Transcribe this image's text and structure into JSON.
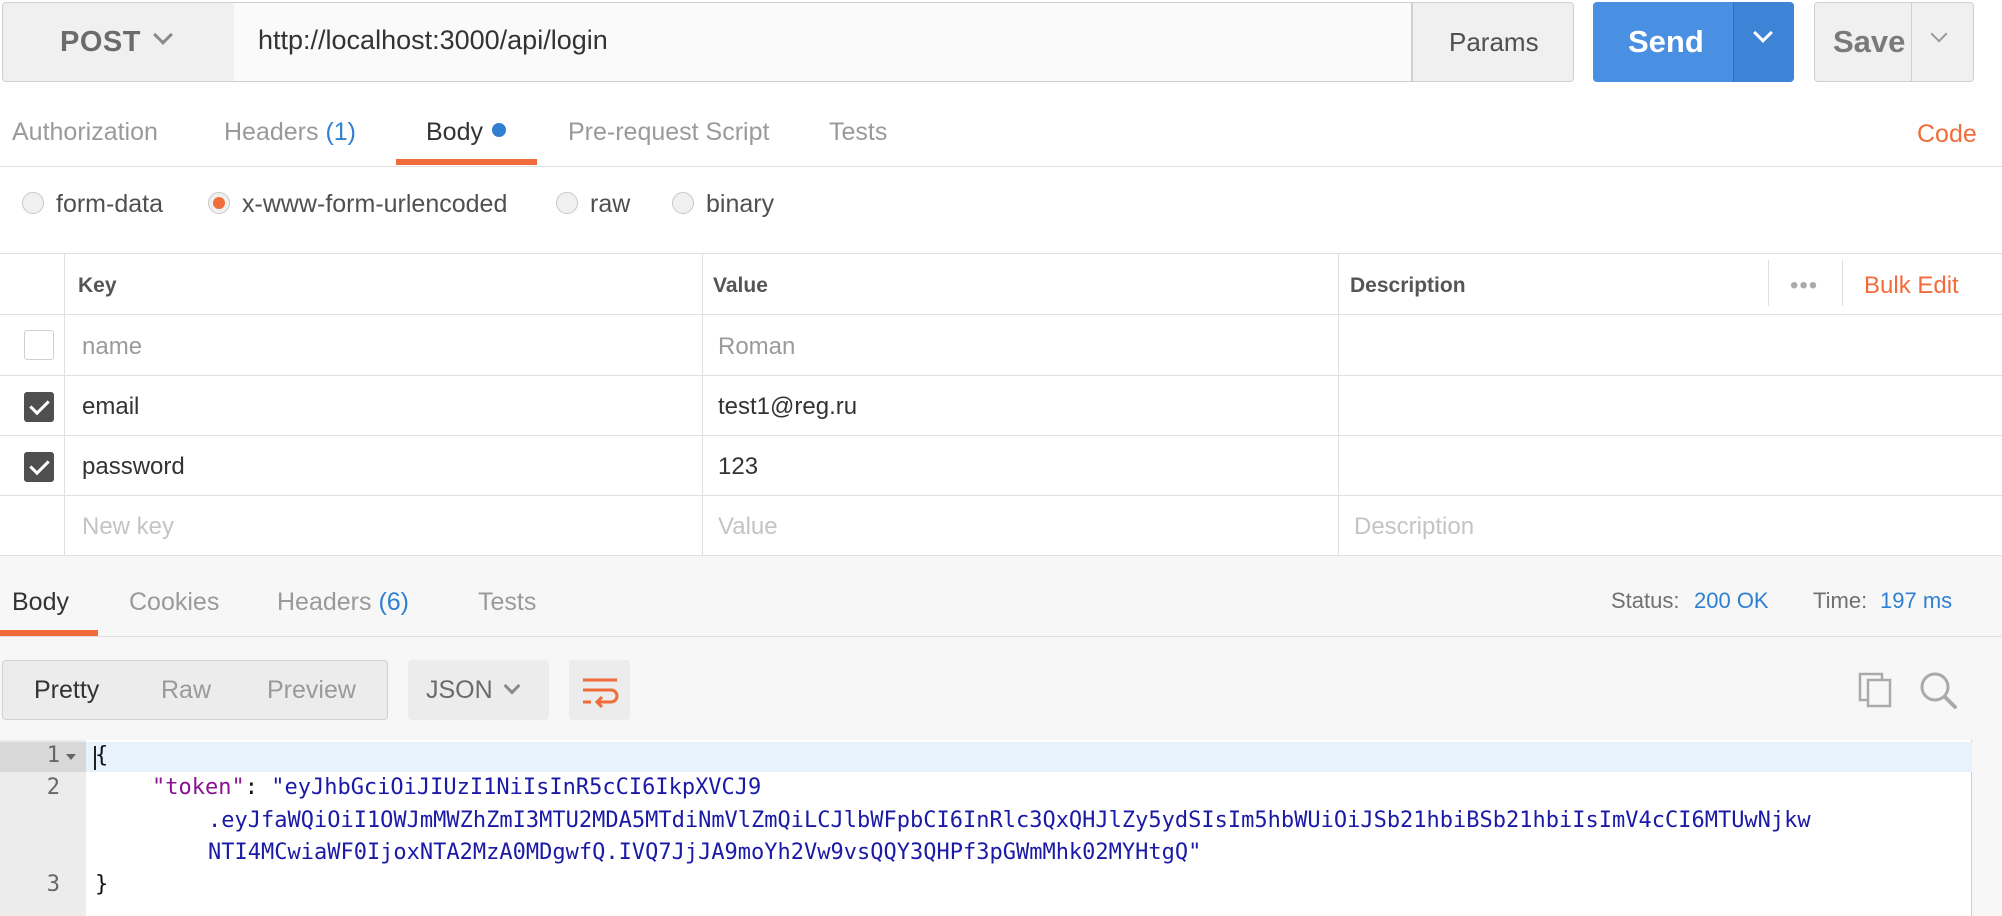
{
  "request": {
    "method": "POST",
    "url": "http://localhost:3000/api/login",
    "params_label": "Params",
    "send_label": "Send",
    "save_label": "Save"
  },
  "request_tabs": [
    {
      "label": "Authorization"
    },
    {
      "label": "Headers",
      "count": "(1)"
    },
    {
      "label": "Body",
      "active": true,
      "modified": true
    },
    {
      "label": "Pre-request Script"
    },
    {
      "label": "Tests"
    }
  ],
  "code_link": "Code",
  "body_types": [
    {
      "label": "form-data",
      "checked": false
    },
    {
      "label": "x-www-form-urlencoded",
      "checked": true
    },
    {
      "label": "raw",
      "checked": false
    },
    {
      "label": "binary",
      "checked": false
    }
  ],
  "params_table": {
    "headers": {
      "key": "Key",
      "value": "Value",
      "description": "Description"
    },
    "more_icon": "ellipsis-icon",
    "bulk_edit": "Bulk Edit",
    "rows": [
      {
        "enabled": false,
        "key": "name",
        "value": "Roman",
        "description": ""
      },
      {
        "enabled": true,
        "key": "email",
        "value": "test1@reg.ru",
        "description": ""
      },
      {
        "enabled": true,
        "key": "password",
        "value": "123",
        "description": ""
      }
    ],
    "placeholders": {
      "key": "New key",
      "value": "Value",
      "description": "Description"
    }
  },
  "response": {
    "tabs": [
      {
        "label": "Body",
        "active": true
      },
      {
        "label": "Cookies"
      },
      {
        "label": "Headers",
        "count": "(6)"
      },
      {
        "label": "Tests"
      }
    ],
    "status_label": "Status:",
    "status_value": "200 OK",
    "time_label": "Time:",
    "time_value": "197 ms",
    "view_modes": [
      "Pretty",
      "Raw",
      "Preview"
    ],
    "format": "JSON",
    "icons": [
      "wrap-lines-icon",
      "copy-icon",
      "search-icon"
    ],
    "code_lines": {
      "line1": "{",
      "key": "\"token\"",
      "colon": ": ",
      "token_part1": "\"eyJhbGciOiJIUzI1NiIsInR5cCI6IkpXVCJ9",
      "token_part2": ".eyJfaWQiOiI1OWJmMWZhZmI3MTU2MDA5MTdiNmVlZmQiLCJlbWFpbCI6InRlc3QxQHJlZy5ydSIsIm5hbWUiOiJSb21hbiBSb21hbiIsImV4cCI6MTUwNjkw",
      "token_part3": "NTI4MCwiaWF0IjoxNTA2MzA0MDgwfQ.IVQ7JjJA9moYh2Vw9vsQQY3QHPf3pGWmMhk02MYHtgQ\"",
      "line3": "}",
      "line_numbers": [
        "1",
        "2",
        "3"
      ]
    }
  },
  "colors": {
    "accent_orange": "#f26b3a",
    "send_blue": "#4a90e2",
    "link_blue": "#2f80d1"
  }
}
